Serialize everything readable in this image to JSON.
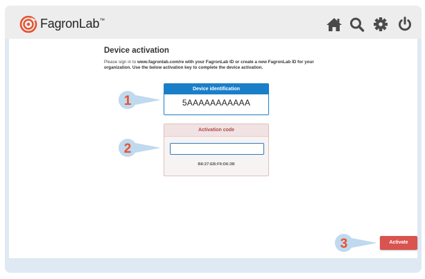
{
  "header": {
    "brand": "FagronLab",
    "trademark": "™",
    "icons": [
      "home-icon",
      "search-icon",
      "gear-icon",
      "power-icon"
    ]
  },
  "page": {
    "title": "Device activation",
    "intro_pre": "Please sign in to ",
    "intro_bold": "www.fagronlab.com/re with your FagronLab ID or create a new FagronLab ID for your organization. Use the below activation key to complete the device activation."
  },
  "device_identification": {
    "label": "Device identification",
    "value": "5AAAAAAAAAAA"
  },
  "activation_code": {
    "label": "Activation code",
    "value": "",
    "mac": "B8:27:EB:F9:D6:3B"
  },
  "callouts": [
    "1",
    "2",
    "3"
  ],
  "actions": {
    "activate_label": "Activate"
  },
  "colors": {
    "accent_blue": "#1a7fc9",
    "accent_red": "#d9534f",
    "callout_fill": "#bfd9ef",
    "callout_number": "#e8502b",
    "brand_orange": "#e8502b"
  }
}
